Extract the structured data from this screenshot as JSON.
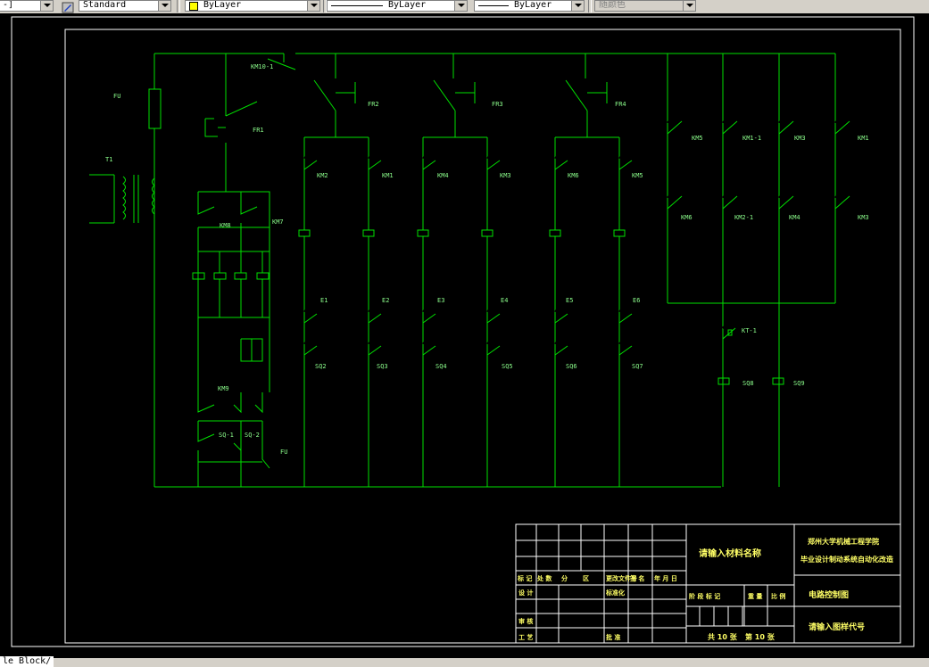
{
  "toolbar": {
    "combo0_value": "-]",
    "textstyle_value": "Standard",
    "layer_value": "ByLayer",
    "linetype_value": "ByLayer",
    "lineweight_value": "ByLayer",
    "plotstyle_value": "随颜色",
    "layer_color": "#ffff00"
  },
  "layout_tab": {
    "label": "le Block/"
  },
  "colors": {
    "wire": "#00e000",
    "label": "#8cff8c",
    "border": "#ffffff",
    "titleblock_text": "#ffff66"
  },
  "schematic": {
    "labels": {
      "fu_left": "FU",
      "t1": "T1",
      "km10_1": "KM10-1",
      "fr1": "FR1",
      "km8": "KM8",
      "km7": "KM7",
      "km9": "KM9",
      "sq1": "SQ-1",
      "sq2": "SQ-2",
      "fu_bottom": "FU",
      "fr2": "FR2",
      "fr3": "FR3",
      "fr4": "FR4",
      "km2": "KM2",
      "km1": "KM1",
      "km4": "KM4",
      "km3": "KM3",
      "km6": "KM6",
      "km5": "KM5",
      "e1": "E1",
      "e2": "E2",
      "e3": "E3",
      "e4": "E4",
      "e5": "E5",
      "e6": "E6",
      "sq2b": "SQ2",
      "sq3": "SQ3",
      "sq4": "SQ4",
      "sq5": "SQ5",
      "sq6": "SQ6",
      "sq7": "SQ7",
      "r_km5": "KM5",
      "r_km1_1": "KM1-1",
      "r_km3": "KM3",
      "r_km1": "KM1",
      "r_km6": "KM6",
      "r_km2_1": "KM2-1",
      "r_km4": "KM4",
      "r_km3b": "KM3",
      "kt1": "KT-1",
      "sq8": "SQ8",
      "sq9": "SQ9"
    }
  },
  "title_block": {
    "material": "请输入材料名称",
    "school_line1": "郑州大学机械工程学院",
    "school_line2": "毕业设计制动系统自动化改造",
    "drawing_name": "电路控制图",
    "drawing_code": "请输入图样代号",
    "rev_headers": [
      "标 记",
      "处 数",
      "分",
      "区",
      "更改文件号",
      "签 名",
      "年 月 日"
    ],
    "design": "设 计",
    "standardize": "标准化",
    "review": "审 核",
    "process": "工 艺",
    "approve": "批 准",
    "stage_headers": [
      "阶 段 标 记",
      "重 量",
      "比 例"
    ],
    "sheets_total": "共 10 张",
    "sheet_num": "第 10 张"
  }
}
